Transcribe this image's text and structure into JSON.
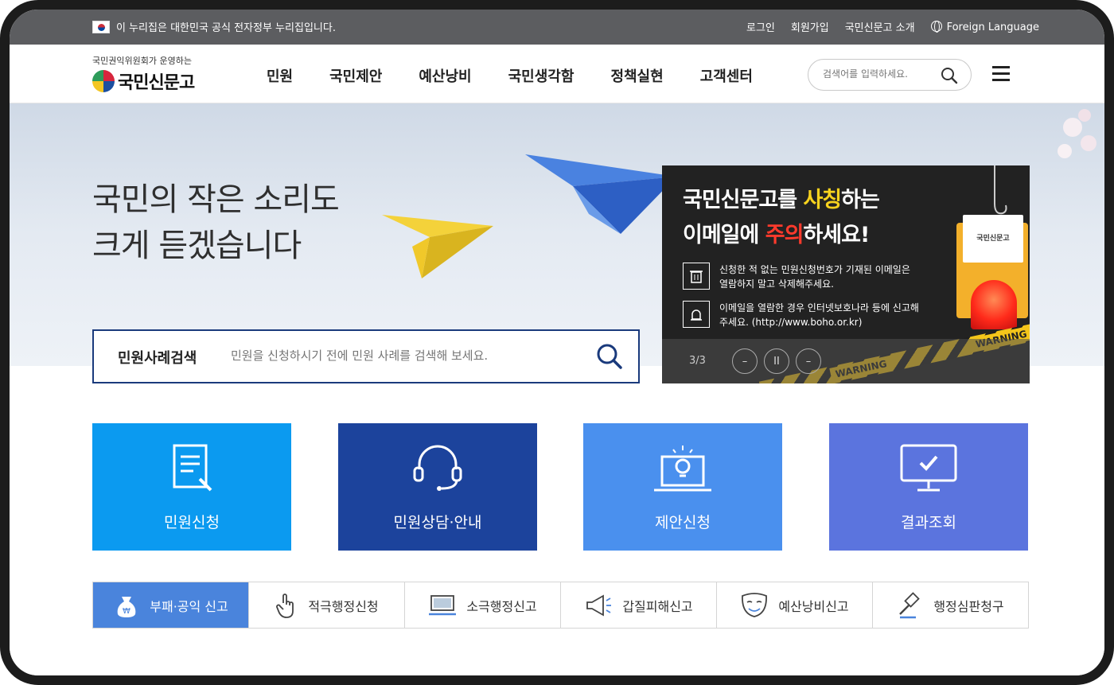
{
  "topbar": {
    "gov_notice": "이 누리집은 대한민국 공식 전자정부 누리집입니다.",
    "links": [
      "로그인",
      "회원가입",
      "국민신문고 소개"
    ],
    "foreign_language": "Foreign Language"
  },
  "header": {
    "logo_sub": "국민권익위원회가 운영하는",
    "logo_text": "국민신문고",
    "nav": [
      "민원",
      "국민제안",
      "예산낭비",
      "국민생각함",
      "정책실현",
      "고객센터"
    ],
    "search_placeholder": "검색어를 입력하세요."
  },
  "hero": {
    "title_line1": "국민의 작은 소리도",
    "title_line2": "크게 듣겠습니다",
    "case_search_label": "민원사례검색",
    "case_search_placeholder": "민원을 신청하시기 전에 민원 사례를 검색해 보세요."
  },
  "banner": {
    "head_line1_a": "국민신문고를 ",
    "head_line1_b": "사칭",
    "head_line1_c": "하는",
    "head_line2_a": "이메일에 ",
    "head_line2_b": "주의",
    "head_line2_c": "하세요!",
    "item1": "신청한 적 없는 민원신청번호가 기재된 이메일은 열람하지 말고 삭제해주세요.",
    "item2": "이메일을 열람한 경우 인터넷보호나라 등에 신고해주세요. (http://www.boho.or.kr)",
    "card_text": "국민신문고",
    "tape_text": "WARNING",
    "pager": "3/3",
    "controls": [
      "–",
      "II",
      "–"
    ]
  },
  "tiles": [
    {
      "label": "민원신청",
      "color": "#0b9af0"
    },
    {
      "label": "민원상담·안내",
      "color": "#1c439c"
    },
    {
      "label": "제안신청",
      "color": "#4a90ee"
    },
    {
      "label": "결과조회",
      "color": "#5b74de"
    }
  ],
  "reports": [
    "부패·공익 신고",
    "적극행정신청",
    "소극행정신고",
    "갑질피해신고",
    "예산낭비신고",
    "행정심판청구"
  ]
}
